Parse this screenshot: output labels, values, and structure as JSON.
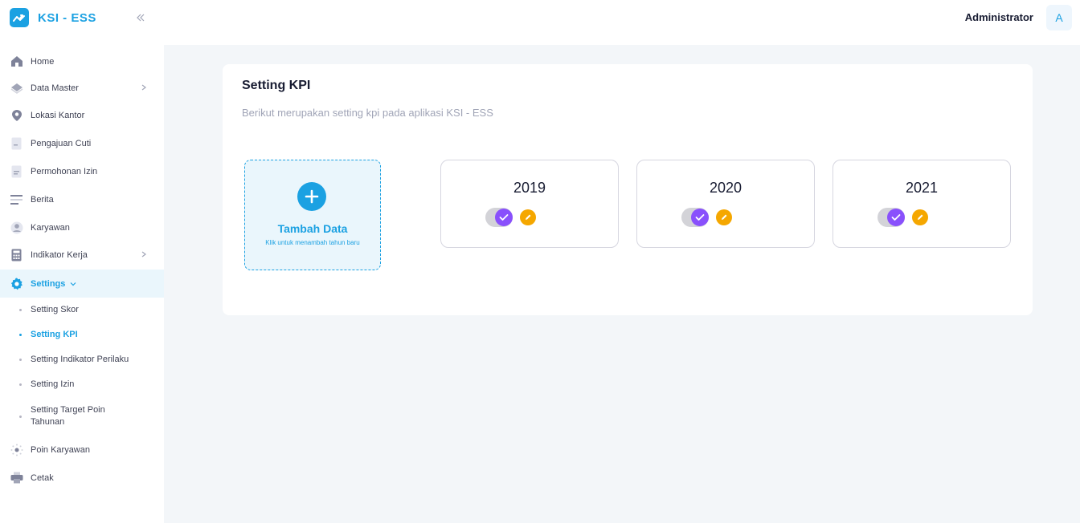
{
  "app": {
    "brand": "KSI - ESS"
  },
  "header": {
    "user_name": "Administrator",
    "avatar_initial": "A"
  },
  "sidebar": {
    "items": [
      {
        "label": "Home",
        "icon": "home-icon"
      },
      {
        "label": "Data Master",
        "icon": "layers-icon",
        "has_arrow": true
      },
      {
        "label": "Lokasi Kantor",
        "icon": "map-pin-icon"
      },
      {
        "label": "Pengajuan Cuti",
        "icon": "document-icon"
      },
      {
        "label": "Permohonan Izin",
        "icon": "document-text-icon"
      },
      {
        "label": "Berita",
        "icon": "news-icon"
      },
      {
        "label": "Karyawan",
        "icon": "user-circle-icon"
      },
      {
        "label": "Indikator Kerja",
        "icon": "calculator-icon",
        "has_arrow": true
      },
      {
        "label": "Settings",
        "icon": "gear-icon",
        "active": true,
        "expanded": true
      }
    ],
    "settings_sub": [
      {
        "label": "Setting Skor"
      },
      {
        "label": "Setting KPI",
        "active": true
      },
      {
        "label": "Setting Indikator Perilaku"
      },
      {
        "label": "Setting Izin"
      },
      {
        "label": "Setting Target Poin Tahunan"
      }
    ],
    "bottom_items": [
      {
        "label": "Poin Karyawan",
        "icon": "sun-icon"
      },
      {
        "label": "Cetak",
        "icon": "printer-icon"
      }
    ]
  },
  "main": {
    "title": "Setting KPI",
    "description": "Berikut merupakan setting kpi pada aplikasi KSI - ESS",
    "add_card": {
      "title": "Tambah Data",
      "subtitle": "Klik untuk menambah tahun baru"
    },
    "years": [
      {
        "year": "2019",
        "enabled": true
      },
      {
        "year": "2020",
        "enabled": true
      },
      {
        "year": "2021",
        "enabled": true
      }
    ]
  },
  "colors": {
    "accent": "#1ba1e2",
    "toggle_on": "#8950fc",
    "edit": "#f5a700"
  }
}
